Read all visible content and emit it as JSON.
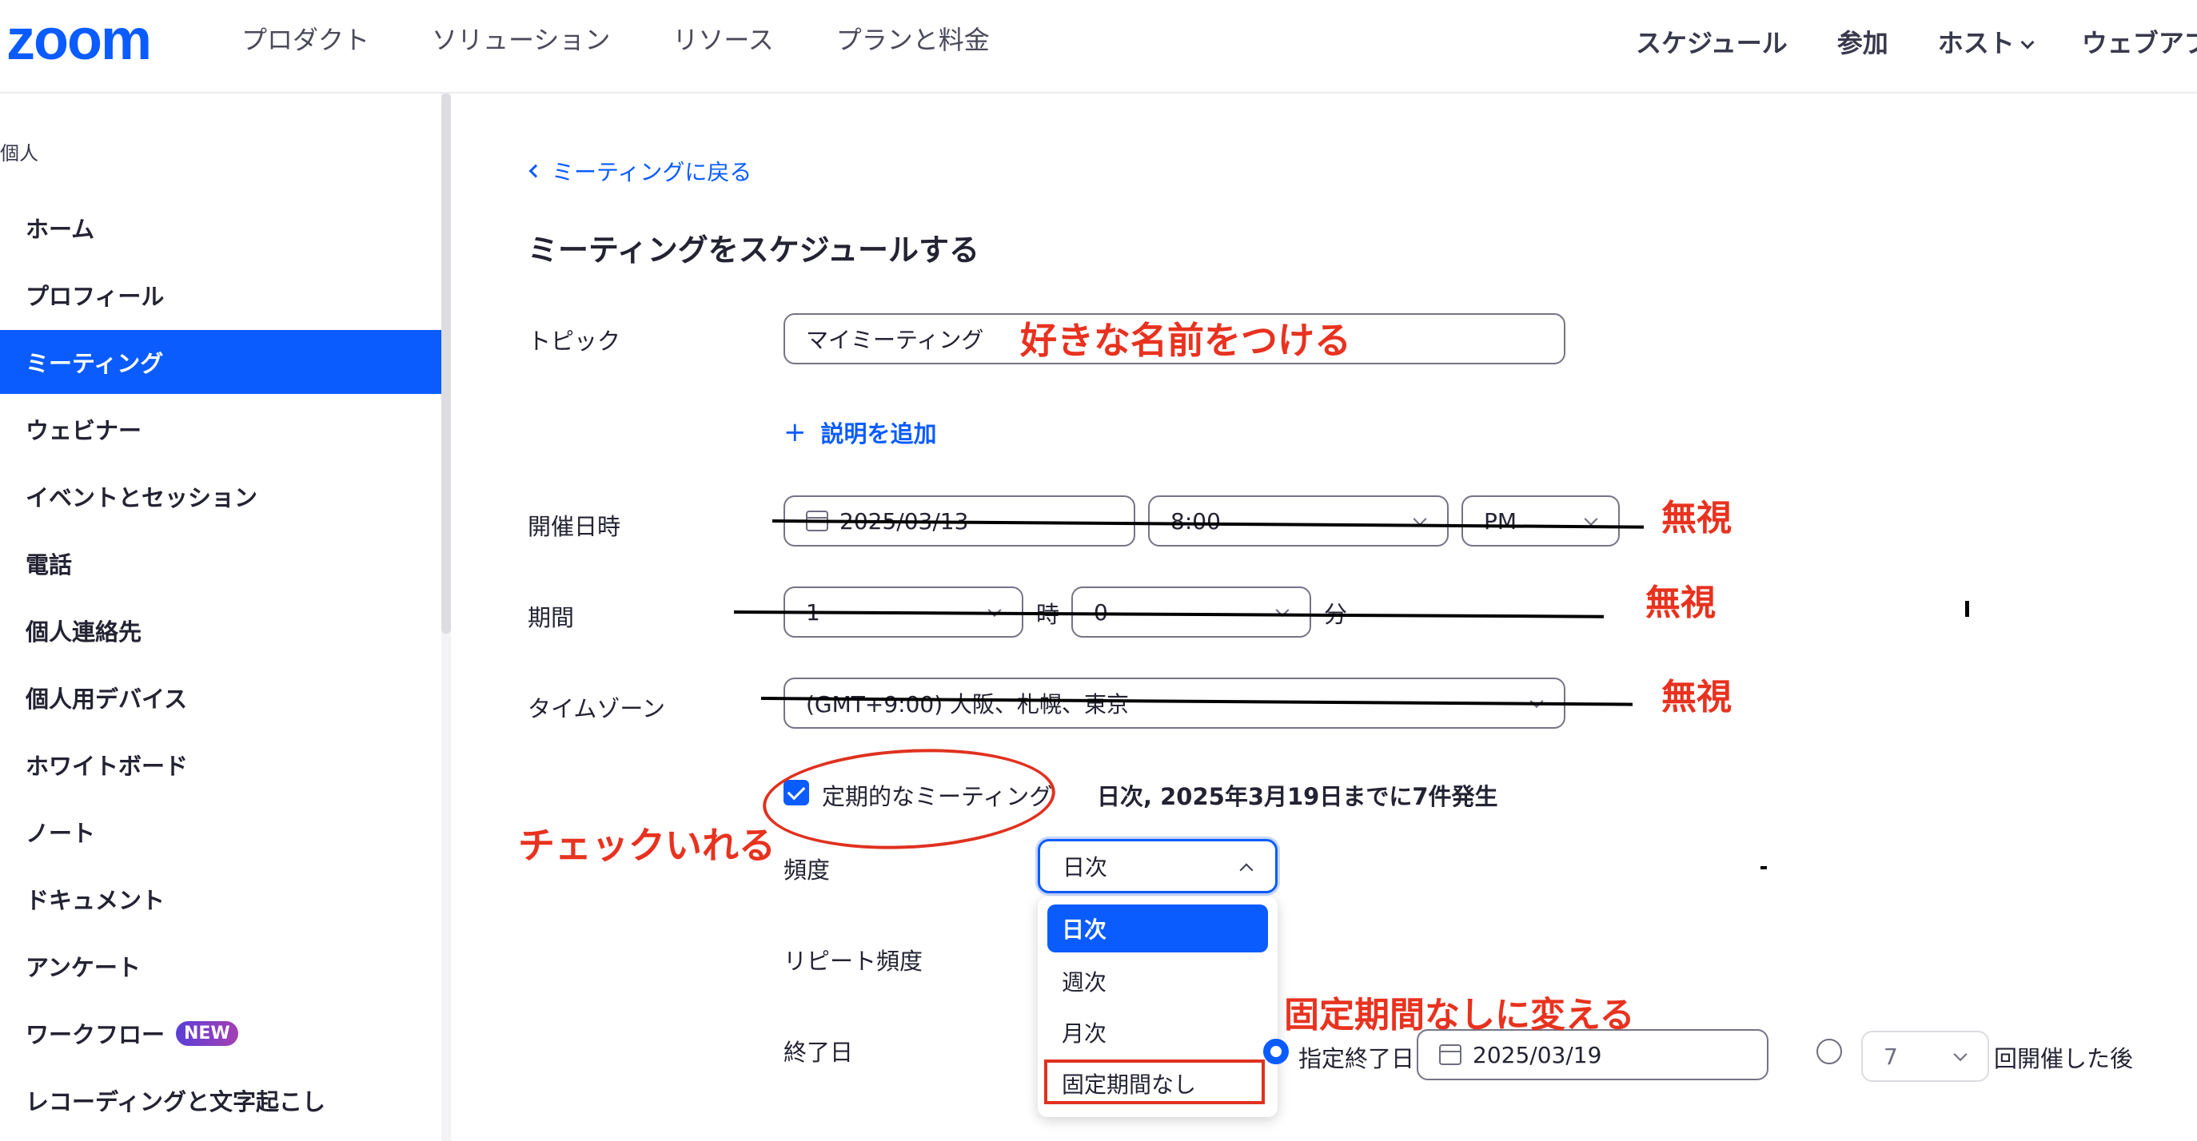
{
  "nav": {
    "logo": "zoom",
    "left": [
      "プロダクト",
      "ソリューション",
      "リソース",
      "プランと料金"
    ],
    "right": {
      "schedule": "スケジュール",
      "join": "参加",
      "host": "ホスト",
      "webapp": "ウェブアプ"
    }
  },
  "sidebar": {
    "section": "個人",
    "items": [
      {
        "label": "ホーム"
      },
      {
        "label": "プロフィール"
      },
      {
        "label": "ミーティング",
        "active": true
      },
      {
        "label": "ウェビナー"
      },
      {
        "label": "イベントとセッション"
      },
      {
        "label": "電話"
      },
      {
        "label": "個人連絡先"
      },
      {
        "label": "個人用デバイス"
      },
      {
        "label": "ホワイトボード"
      },
      {
        "label": "ノート"
      },
      {
        "label": "ドキュメント"
      },
      {
        "label": "アンケート"
      },
      {
        "label": "ワークフロー",
        "badge": "NEW"
      },
      {
        "label": "レコーディングと文字起こし"
      }
    ]
  },
  "main": {
    "back_link": "ミーティングに戻る",
    "title": "ミーティングをスケジュールする",
    "topic": {
      "label": "トピック",
      "value": "マイミーティング"
    },
    "add_description": "説明を追加",
    "datetime": {
      "label": "開催日時",
      "date": "2025/03/13",
      "time": "8:00",
      "ampm": "PM"
    },
    "duration": {
      "label": "期間",
      "hours": "1",
      "hours_unit": "時",
      "minutes": "0",
      "minutes_unit": "分"
    },
    "timezone": {
      "label": "タイムゾーン",
      "value": "(GMT+9:00) 大阪、札幌、東京"
    },
    "recurring": {
      "label": "定期的なミーティング",
      "summary": "日次, 2025年3月19日までに7件発生",
      "checked": true
    },
    "frequency": {
      "label": "頻度",
      "value": "日次",
      "options": [
        "日次",
        "週次",
        "月次",
        "固定期間なし"
      ]
    },
    "repeat_every": {
      "label": "リピート頻度"
    },
    "end_date": {
      "label": "終了日",
      "by_date_label": "指定終了日",
      "date": "2025/03/19",
      "occurrences": "7",
      "after_label": "回開催した後"
    }
  },
  "annotations": {
    "name_it": "好きな名前をつける",
    "ignore_1": "無視",
    "ignore_2": "無視",
    "ignore_3": "無視",
    "check_it": "チェックいれる",
    "change_to": "固定期間なしに変える"
  },
  "colors": {
    "accent": "#0b5cff",
    "annotation": "#e8321f"
  }
}
